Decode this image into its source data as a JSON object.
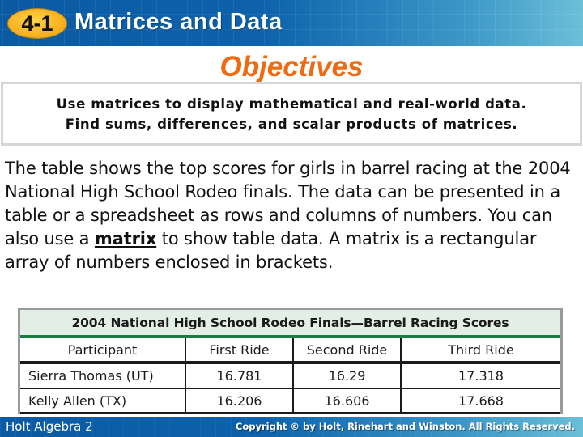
{
  "header": {
    "lesson_number": "4-1",
    "title": "Matrices and Data"
  },
  "objectives": {
    "title": "Objectives",
    "items": [
      "Use matrices to display mathematical and real-world data.",
      "Find sums, differences, and scalar products of matrices."
    ]
  },
  "body": {
    "text_before": "The table shows the top scores for girls in barrel racing at the 2004 National High School Rodeo finals. The data can be presented in a table or a spreadsheet as rows and columns of numbers. You can also use a ",
    "term": "matrix",
    "text_after": " to show table data. A matrix is a rectangular array of numbers enclosed in brackets."
  },
  "table": {
    "caption": "2004 National High School Rodeo Finals—Barrel Racing Scores",
    "columns": [
      "Participant",
      "First Ride",
      "Second Ride",
      "Third Ride"
    ],
    "rows": [
      [
        "Sierra Thomas (UT)",
        "16.781",
        "16.29",
        "17.318"
      ],
      [
        "Kelly Allen (TX)",
        "16.206",
        "16.606",
        "17.668"
      ]
    ],
    "header_color": "#e3efe6",
    "accent_color": "#1e7a43"
  },
  "footer": {
    "book": "Holt Algebra 2",
    "copyright": "Copyright © by Holt, Rinehart and Winston. All Rights Reserved."
  },
  "colors": {
    "header_blue": "#0b5ea6",
    "badge_orange": "#f7b21f",
    "objectives_orange": "#ef6a10"
  }
}
